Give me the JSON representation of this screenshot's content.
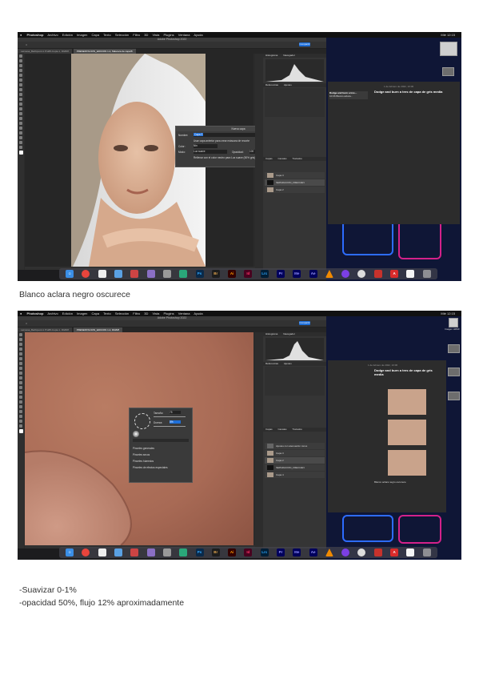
{
  "menubar": {
    "app": "Photoshop",
    "items": [
      "Archivo",
      "Edición",
      "Imagen",
      "Capa",
      "Texto",
      "Selección",
      "Filtro",
      "3D",
      "Vista",
      "Plugins",
      "Ventana",
      "Ayuda"
    ],
    "clock": "Mié 12:15"
  },
  "ps": {
    "window_title": "Adobe Photoshop 2022",
    "share_label": "Compartir",
    "panel_tabs": [
      "Histograma",
      "Navegador"
    ],
    "panel_tabs2": [
      "Referencias",
      "Ajustes"
    ],
    "layer_tabs": [
      "Capas",
      "Canales",
      "Trazados"
    ]
  },
  "shot1": {
    "tabs": [
      "Laimosa_Barbipunk A Pro88-Copia 1, RGB/8",
      "PRESENTACION_EDICION 1.2, Máscara de capa/8"
    ],
    "dialog": {
      "title": "Nueva capa",
      "name_label": "Nombre:",
      "name_value": "Capa 3",
      "ok": "OK",
      "cancel": "Cancelar",
      "clip_label": "Usar capa anterior para crear máscara de recorte",
      "color_label": "Color:",
      "color_value": "Nin",
      "mode_label": "Modo:",
      "mode_value": "Luz suave",
      "opacity_label": "Opacidad:",
      "opacity_value": "100",
      "neutral_label": "Rellenar con el color neutro para Luz suave (50% gris)"
    },
    "layers": [
      "Capa 3",
      "SEPARACION_FRECUEN",
      "Capa 2"
    ],
    "notes": {
      "date": "1 de febrero de 2022, 10:06",
      "title": "Dodge and burn a tres de capa de gris media",
      "preview_title": "Dodge and burn a tres...",
      "preview_time": "10:06",
      "preview_text": "Blanco aclara..."
    }
  },
  "shot2": {
    "tabs": [
      "Laimosa_Barbipunk A Pro88-Copia 1, RGB/8",
      "PRESENTACION_EDICION 1.2, RGB/8"
    ],
    "brush_panel": {
      "size_label": "Tamaño:",
      "size_value": "75",
      "hardness_label": "Dureza:",
      "hardness_value": "0%",
      "presets": [
        "Pinceles generales",
        "Pinceles secos",
        "Pinceles húmedos",
        "Pinceles de efectos especiales"
      ]
    },
    "layers": [
      "Ajustes con atenuación tonos",
      "Capa 3",
      "Capa 2",
      "SEPARACION_FRECUEN",
      "Capa 4"
    ],
    "notes": {
      "date": "1 de febrero de 2022, 10:06",
      "title": "Dodge and burn a tres de capa de gris media",
      "footer": "Blanco aclara negro oscurece"
    },
    "desk_label": "Imagen HDMI"
  },
  "dock": {
    "icons": [
      "finder",
      "chrome",
      "document",
      "preview",
      "image",
      "notes",
      "bear",
      "paint",
      "Ps",
      "Br",
      "Ai",
      "Id",
      "Lrc",
      "Pr",
      "Me",
      "Ae",
      "vlc",
      "circle",
      "wheel",
      "tools",
      "Ac",
      "pages",
      "trash"
    ]
  },
  "captions": {
    "caption1": "Blanco aclara negro oscurece",
    "caption2": "-Suavizar 0-1%",
    "caption3": "-opacidad 50%, flujo 12% aproximadamente"
  },
  "colors": {
    "ps_blue": "#1e6fd9",
    "desktop": "#0f1636",
    "neon_blue": "#2d6cff",
    "neon_pink": "#d4218a"
  }
}
